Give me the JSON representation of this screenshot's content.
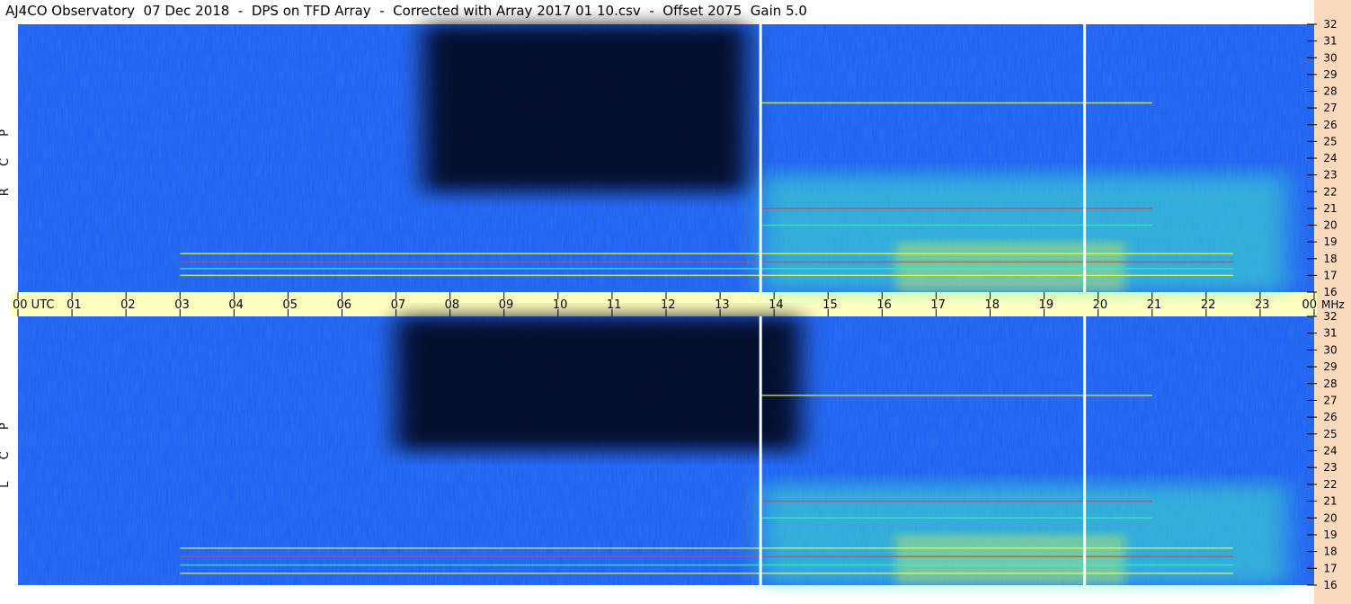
{
  "title": "AJ4CO Observatory  07 Dec 2018  -  DPS on TFD Array  -  Corrected with Array 2017 01 10.csv  -  Offset 2075  Gain 5.0",
  "colors": {
    "time_band": "#ffffc0",
    "freq_strip": "#fbd9bd",
    "marker_line": "#ffffff",
    "spectrogram_base": "#1a5cf0",
    "spectrogram_dark": "#000010",
    "activity_cyan": "#3fe6c8",
    "activity_yellow": "#e8ff40",
    "activity_red": "#ff3050"
  },
  "chart_data": [
    {
      "type": "heatmap",
      "panel": "top",
      "polarization": "R C P",
      "x": [
        "00 UTC",
        "01",
        "02",
        "03",
        "04",
        "05",
        "06",
        "07",
        "08",
        "09",
        "10",
        "11",
        "12",
        "13",
        "14",
        "15",
        "16",
        "17",
        "18",
        "19",
        "20",
        "21",
        "22",
        "23",
        "00"
      ],
      "xlabel": "UTC",
      "y_ticks": [
        "16",
        "17",
        "18",
        "19",
        "20",
        "21",
        "22",
        "23",
        "24",
        "25",
        "26",
        "27",
        "28",
        "29",
        "30",
        "31",
        "32"
      ],
      "ylabel": "MHz",
      "xlim": [
        0,
        24
      ],
      "ylim": [
        16,
        32
      ],
      "markers_hours": [
        13.75,
        19.75
      ],
      "dark_region": {
        "x": [
          7.5,
          13.5
        ],
        "y": [
          22,
          32
        ]
      },
      "active_region": {
        "x": [
          13.75,
          23.5
        ],
        "y": [
          16,
          23
        ]
      },
      "bright_lines_mhz": [
        17.0,
        17.4,
        17.8,
        18.3,
        20.0,
        21.0,
        27.3
      ]
    },
    {
      "type": "heatmap",
      "panel": "bottom",
      "polarization": "L C P",
      "x": [
        "00 UTC",
        "01",
        "02",
        "03",
        "04",
        "05",
        "06",
        "07",
        "08",
        "09",
        "10",
        "11",
        "12",
        "13",
        "14",
        "15",
        "16",
        "17",
        "18",
        "19",
        "20",
        "21",
        "22",
        "23",
        "00"
      ],
      "xlabel": "UTC",
      "y_ticks": [
        "16",
        "17",
        "18",
        "19",
        "20",
        "21",
        "22",
        "23",
        "24",
        "25",
        "26",
        "27",
        "28",
        "29",
        "30",
        "31",
        "32"
      ],
      "ylabel": "MHz",
      "xlim": [
        0,
        24
      ],
      "ylim": [
        16,
        32
      ],
      "markers_hours": [
        13.75,
        19.75
      ],
      "dark_region": {
        "x": [
          7.0,
          14.5
        ],
        "y": [
          24,
          32
        ]
      },
      "active_region": {
        "x": [
          13.75,
          23.5
        ],
        "y": [
          16,
          22
        ]
      },
      "bright_lines_mhz": [
        16.7,
        17.2,
        17.7,
        18.2,
        20.0,
        21.0,
        27.3
      ]
    }
  ]
}
